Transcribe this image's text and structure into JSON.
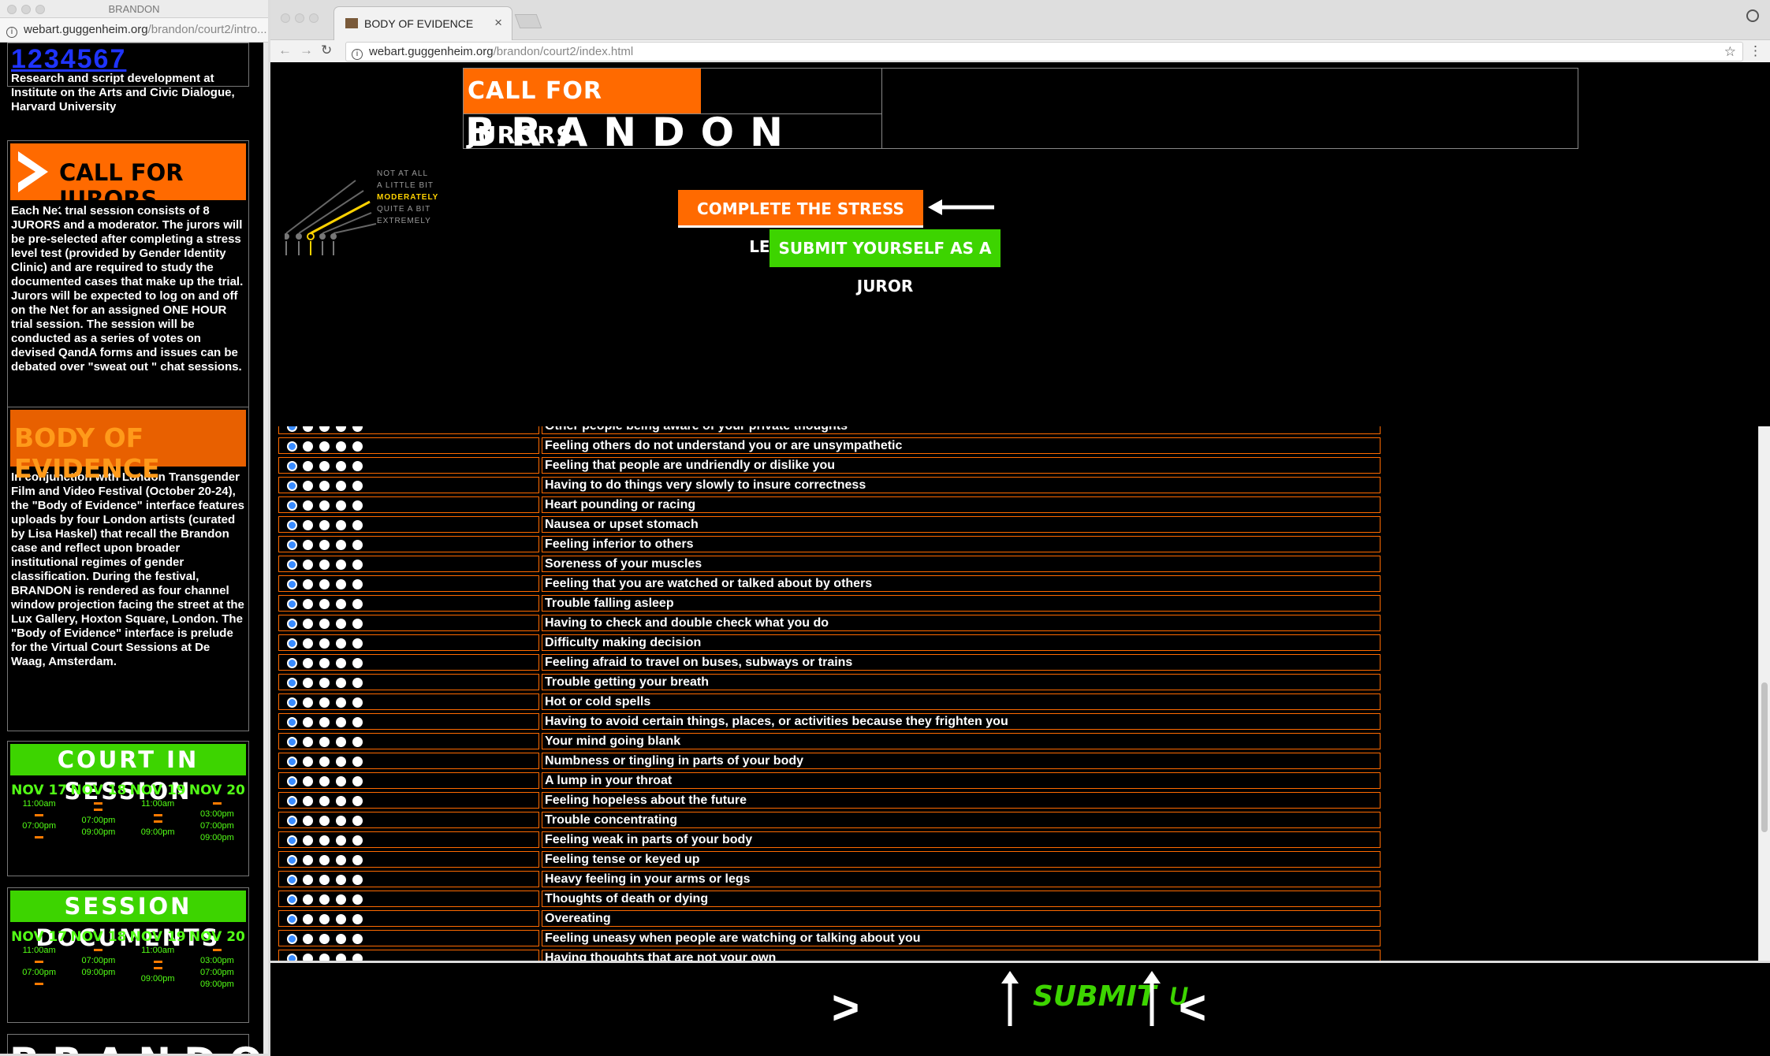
{
  "left_window": {
    "title": "BRANDON",
    "url_host": "webart.guggenheim.org",
    "url_path": "/brandon/court2/intro...",
    "page_numbers": "1234567",
    "research_text": "Research and script development at Institute on the Arts and Civic Dialogue, Harvard University",
    "call_for_jurors_title": "CALL FOR JURORS",
    "call_for_jurors_text": "Each Net trial session consists of 8 JURORS and a moderator. The jurors will be pre-selected after completing a stress level test (provided by Gender Identity Clinic) and are required to study the documented cases that make up the trial. Jurors will be expected to log on and off on the Net for an assigned ONE HOUR trial session. The session will be conducted as a series of votes on devised QandA forms and issues can be debated over \"sweat out \" chat sessions.",
    "body_of_evidence_title": "BODY OF EVIDENCE",
    "body_of_evidence_text": "In conjunction with London Transgender Film and Video Festival (October 20-24), the \"Body of Evidence\" interface features uploads by four London artists (curated by Lisa Haskel) that recall the Brandon case and reflect upon broader institutional regimes of gender classification. During the festival, BRANDON is rendered as four channel window projection facing the street at the Lux Gallery, Hoxton Square, London. The \"Body of Evidence\" interface is prelude for the Virtual Court Sessions at De Waag, Amsterdam.",
    "court_in_session_title": "COURT IN SESSION",
    "session_documents_title": "SESSION DOCUMENTS",
    "schedule": [
      {
        "date": "NOV 17",
        "t1": "11:00am",
        "t2": "07:00pm",
        "t3": ""
      },
      {
        "date": "NOV 18",
        "t1": "",
        "t2": "07:00pm",
        "t3": "09:00pm"
      },
      {
        "date": "NOV 19",
        "t1": "11:00am",
        "t2": "",
        "t3": "09:00pm"
      },
      {
        "date": "NOV 20",
        "t1": "",
        "t2": "03:00pm",
        "t3": "07:00pm",
        "t4": "09:00pm"
      }
    ],
    "brandon_logo": "BRANDON"
  },
  "browser": {
    "tab_title": "BODY OF EVIDENCE",
    "url_host": "webart.guggenheim.org",
    "url_path": "/brandon/court2/index.html"
  },
  "page": {
    "call_for_jurors": "CALL FOR JURORS",
    "brandon": "BRANDON",
    "stress_test_button": "COMPLETE THE STRESS LEVEL TEST",
    "juror_button": "SUBMIT YOURSELF AS A JUROR",
    "scale_labels": [
      "NOT AT ALL",
      "A LITTLE BIT",
      "MODERATELY",
      "QUITE A BIT",
      "EXTREMELY"
    ],
    "scale_highlight_index": 2,
    "questions": [
      "Other people being aware of your private thoughts",
      "Feeling others do not understand you or are unsympathetic",
      "Feeling that people are undriendly or dislike you",
      "Having to do things very slowly to insure correctness",
      "Heart pounding or racing",
      "Nausea or upset stomach",
      "Feeling inferior to others",
      "Soreness of your muscles",
      "Feeling that you are watched or talked about by others",
      "Trouble falling asleep",
      "Having to check and double check what you do",
      "Difficulty making decision",
      "Feeling afraid to travel on buses, subways or trains",
      "Trouble getting your breath",
      "Hot or cold spells",
      "Having to avoid certain things, places, or activities because they frighten you",
      "Your mind going blank",
      "Numbness or tingling in parts of your body",
      "A lump in your throat",
      "Feeling hopeless about the future",
      "Trouble concentrating",
      "Feeling weak in parts of your body",
      "Feeling tense or keyed up",
      "Heavy feeling in your arms or legs",
      "Thoughts of death or dying",
      "Overeating",
      "Feeling uneasy when people are watching or talking about you",
      "Having thoughts that are not your own"
    ],
    "bottom": {
      "next": ">",
      "submit": "SUBMIT",
      "u": "U",
      "prev": "<"
    }
  },
  "colors": {
    "orange": "#ff6a00",
    "green": "#3dd400",
    "link_blue": "#1f34ff",
    "radio_selected": "#3a8cff"
  }
}
